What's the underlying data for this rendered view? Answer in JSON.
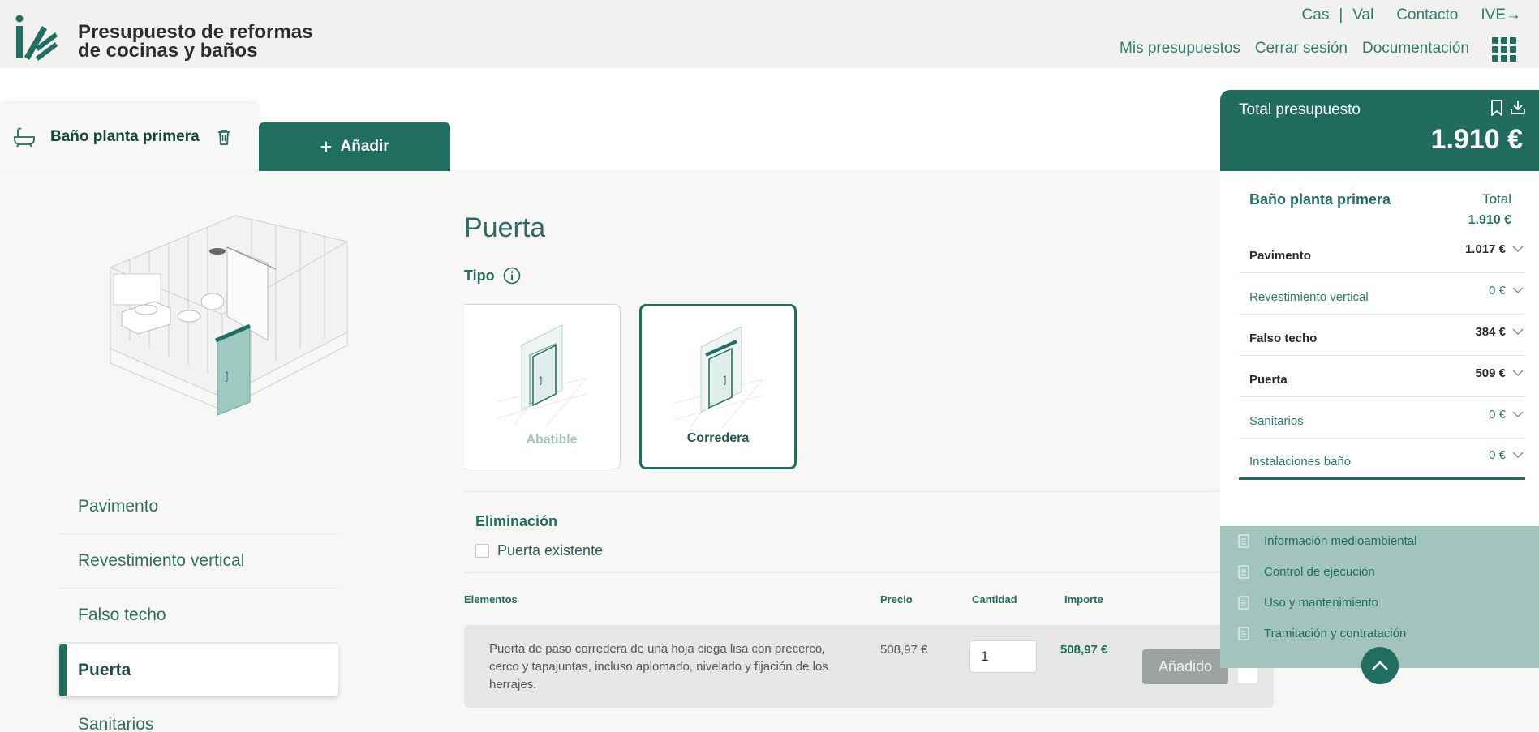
{
  "header": {
    "title_line1": "Presupuesto de reformas",
    "title_line2": "de cocinas y baños",
    "lang": [
      "Cas",
      "|",
      "Val"
    ],
    "contact": "Contacto",
    "ive": "IVE→",
    "nav": [
      "Mis presupuestos",
      "Cerrar sesión",
      "Documentación"
    ]
  },
  "tabs": {
    "active_label": "Baño planta primera",
    "add_label": "Añadir",
    "add_symbol": "+"
  },
  "left_nav": {
    "items": [
      "Pavimento",
      "Revestimiento vertical",
      "Falso techo",
      "Puerta",
      "Sanitarios"
    ],
    "active": "Puerta"
  },
  "main": {
    "title": "Puerta",
    "tipo_label": "Tipo",
    "options": [
      {
        "label": "Abatible",
        "selected": false
      },
      {
        "label": "Corredera",
        "selected": true
      }
    ],
    "elim_title": "Eliminación",
    "elim_checkbox_label": "Puerta existente",
    "elim_checked": false,
    "table_headers": {
      "elementos": "Elementos",
      "precio": "Precio",
      "cantidad": "Cantidad",
      "importe": "Importe"
    },
    "row": {
      "description": "Puerta de paso corredera de una hoja ciega lisa con precerco, cerco y tapajuntas, incluso aplomado, nivelado y fijación de los herrajes.",
      "price": "508,97 €",
      "quantity": "1",
      "total": "508,97 €",
      "button": "Añadido"
    }
  },
  "summary": {
    "header_label": "Total presupuesto",
    "header_amount": "1.910 €",
    "room_title": "Baño planta primera",
    "total_label": "Total",
    "total_value": "1.910 €",
    "items": [
      {
        "name": "Pavimento",
        "value": "1.017 €",
        "bold": true
      },
      {
        "name": "Revestimiento vertical",
        "value": "0 €",
        "bold": false
      },
      {
        "name": "Falso techo",
        "value": "384 €",
        "bold": true
      },
      {
        "name": "Puerta",
        "value": "509 €",
        "bold": true
      },
      {
        "name": "Sanitarios",
        "value": "0 €",
        "bold": false
      },
      {
        "name": "Instalaciones baño",
        "value": "0 €",
        "bold": false
      }
    ],
    "docs": [
      "Información medioambiental",
      "Control de ejecución",
      "Uso y mantenimiento",
      "Tramitación y contratación"
    ]
  },
  "colors": {
    "primary": "#1f6e60",
    "accent_light": "#a3c3bd",
    "background": "#f7f7f5"
  }
}
